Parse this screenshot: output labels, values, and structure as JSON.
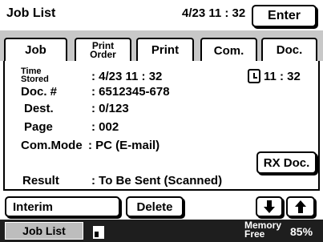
{
  "header": {
    "title": "Job List",
    "datetime": "4/23 11 : 32",
    "enter_label": "Enter"
  },
  "tabs": [
    {
      "label": "Job"
    },
    {
      "label_line1": "Print",
      "label_line2": "Order"
    },
    {
      "label": "Print"
    },
    {
      "label": "Com."
    },
    {
      "label": "Doc."
    }
  ],
  "details": {
    "time_stored_line1": "Time",
    "time_stored_line2": "Stored",
    "time_stored_value": ": 4/23  11 : 32",
    "clock_value": "11 : 32",
    "doc_label": "Doc. #",
    "doc_value": ": 6512345-678",
    "dest_label": "Dest.",
    "dest_value": ":   0/123",
    "page_label": "Page",
    "page_value": ": 002",
    "commode_label": "Com.Mode",
    "commode_value": ": PC (E-mail)",
    "rx_label": "RX Doc.",
    "result_label": "Result",
    "result_value": ": To Be Sent (Scanned)"
  },
  "actions": {
    "interim_label": "Interim",
    "delete_label": "Delete",
    "down_icon": "arrow-down-icon",
    "up_icon": "arrow-up-icon"
  },
  "footer": {
    "joblist_label": "Job List",
    "memory_line1": "Memory",
    "memory_line2": "Free",
    "memory_value": "85%"
  }
}
